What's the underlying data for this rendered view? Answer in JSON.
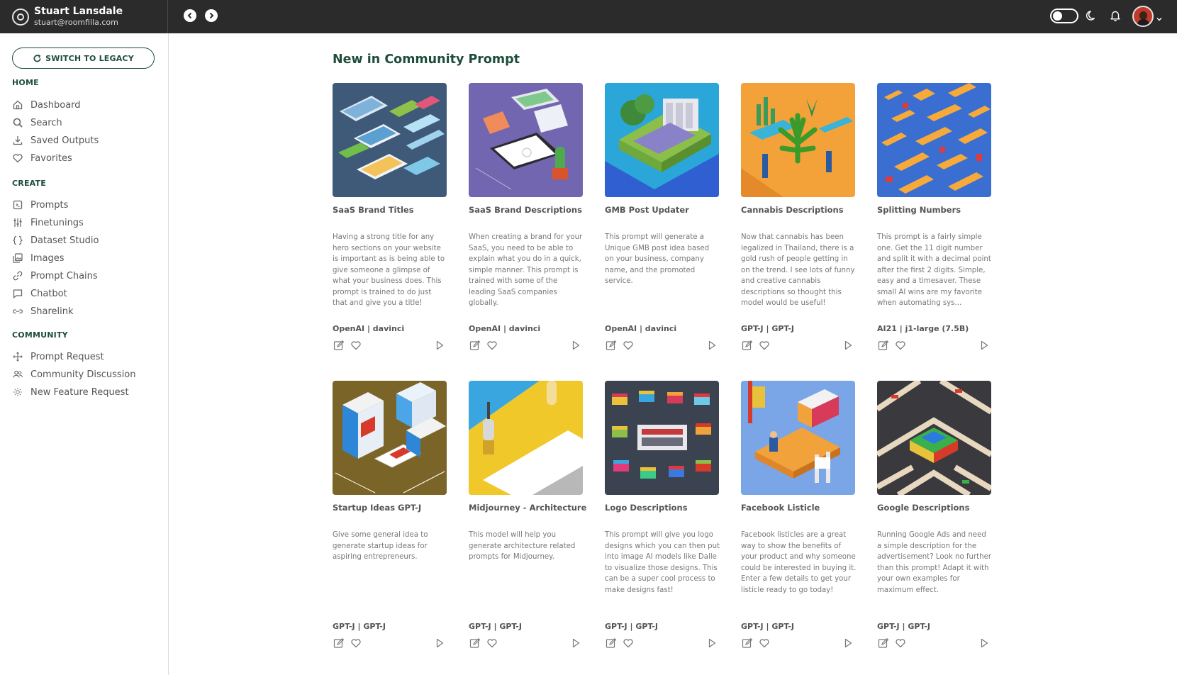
{
  "user": {
    "name": "Stuart Lansdale",
    "email": "stuart@roomfilla.com"
  },
  "sidebar": {
    "legacy_button": "SWITCH TO LEGACY",
    "sections": [
      {
        "title": "HOME",
        "items": [
          {
            "label": "Dashboard",
            "icon": "home-icon"
          },
          {
            "label": "Search",
            "icon": "search-icon"
          },
          {
            "label": "Saved Outputs",
            "icon": "download-icon"
          },
          {
            "label": "Favorites",
            "icon": "heart-icon"
          }
        ]
      },
      {
        "title": "CREATE",
        "items": [
          {
            "label": "Prompts",
            "icon": "prompt-icon"
          },
          {
            "label": "Finetunings",
            "icon": "sliders-icon"
          },
          {
            "label": "Dataset Studio",
            "icon": "braces-icon"
          },
          {
            "label": "Images",
            "icon": "images-icon"
          },
          {
            "label": "Prompt Chains",
            "icon": "link-icon"
          },
          {
            "label": "Chatbot",
            "icon": "chat-icon"
          },
          {
            "label": "Sharelink",
            "icon": "share-link-icon"
          }
        ]
      },
      {
        "title": "COMMUNITY",
        "items": [
          {
            "label": "Prompt Request",
            "icon": "move-icon"
          },
          {
            "label": "Community Discussion",
            "icon": "users-icon"
          },
          {
            "label": "New Feature Request",
            "icon": "sparkle-icon"
          }
        ]
      }
    ]
  },
  "main": {
    "title": "New in Community Prompt",
    "cards": [
      {
        "title": "SaaS Brand Titles",
        "description": "Having a strong title for any hero sections on your website is important as is being able to give someone a glimpse of what your business does. This prompt is trained to do just that and give you a title!",
        "model": "OpenAI | davinci",
        "image": "saas-titles-illustration"
      },
      {
        "title": "SaaS Brand Descriptions",
        "description": "When creating a brand for your SaaS, you need to be able to explain what you do in a quick, simple manner. This prompt is trained with some of the leading SaaS companies globally.",
        "model": "OpenAI | davinci",
        "image": "saas-descriptions-illustration"
      },
      {
        "title": "GMB Post Updater",
        "description": "This prompt will generate a Unique GMB post idea based on your business, company name, and the promoted service.",
        "model": "OpenAI | davinci",
        "image": "gmb-post-illustration"
      },
      {
        "title": "Cannabis Descriptions",
        "description": "Now that cannabis has been legalized in Thailand, there is a gold rush of people getting in on the trend. I see lots of funny and creative cannabis descriptions so thought this model would be useful!",
        "model": "GPT-J | GPT-J",
        "image": "cannabis-illustration"
      },
      {
        "title": "Splitting Numbers",
        "description": "This prompt is a fairly simple one. Get the 11 digit number and split it with a decimal point after the first 2 digits. Simple, easy and a timesaver. These small AI wins are my favorite when automating sys...",
        "model": "AI21 | j1-large (7.5B)",
        "image": "splitting-numbers-illustration"
      },
      {
        "title": "Startup Ideas GPT-J",
        "description": "Give some general idea to generate startup ideas for aspiring entrepreneurs.",
        "model": "GPT-J | GPT-J",
        "image": "startup-ideas-illustration"
      },
      {
        "title": "Midjourney - Architecture",
        "description": "This model will help you generate architecture related prompts for Midjourney.",
        "model": "GPT-J | GPT-J",
        "image": "architecture-illustration"
      },
      {
        "title": "Logo Descriptions",
        "description": "This prompt will give you logo designs which you can then put into image AI models like Dalle to visualize those designs. This can be a super cool process to make designs fast!",
        "model": "GPT-J | GPT-J",
        "image": "logo-descriptions-illustration"
      },
      {
        "title": "Facebook Listicle",
        "description": "Facebook listicles are a great way to show the benefits of your product and why someone could be interested in buying it. Enter a few details to get your listicle ready to go today!",
        "model": "GPT-J | GPT-J",
        "image": "facebook-listicle-illustration"
      },
      {
        "title": "Google Descriptions",
        "description": "Running Google Ads and need a simple description for the advertisement? Look no further than this prompt! Adapt it with your own examples for maximum effect.",
        "model": "GPT-J | GPT-J",
        "image": "google-descriptions-illustration"
      }
    ]
  },
  "colors": {
    "accent": "#1e4d3a",
    "topbar": "#2b2b2b"
  }
}
